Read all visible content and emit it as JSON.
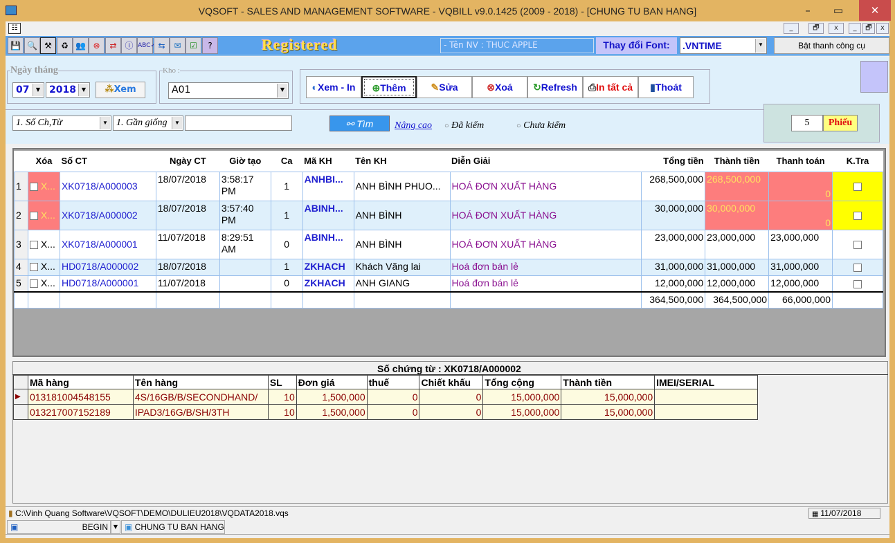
{
  "window": {
    "title": "VQSOFT - SALES AND MANAGEMENT SOFTWARE - VQBILL v9.0.1425 (2009 - 2018) - [CHUNG TU BAN HANG]",
    "minimize": "–",
    "maximize": "▭",
    "close": "✕"
  },
  "mdi": {
    "minimize": "_",
    "restore": "🗗",
    "close": "x"
  },
  "toolbar": {
    "icons": [
      "save-icon",
      "search-user-icon",
      "tools-icon",
      "refresh-doc-icon",
      "users-icon",
      "cancel-icon",
      "exchange-icon",
      "info-icon",
      "spellcheck-icon",
      "teamviewer-icon",
      "mail-icon",
      "check-icon",
      "help-icon"
    ],
    "registered": "Registered",
    "employee": "- Tên NV : THUC APPLE",
    "font_label": "Thay đổi Font:",
    "font_value": ".VNTIME",
    "toggle_toolbar": "Bật thanh công cụ"
  },
  "filters": {
    "date_legend": "Ngày tháng",
    "month": "07",
    "year": "2018",
    "view": "Xem",
    "warehouse_legend": "Kho :",
    "warehouse": "A01"
  },
  "actions": {
    "print": "Xem - In",
    "add": "Thêm",
    "edit": "Sửa",
    "delete": "Xoá",
    "refresh": "Refresh",
    "print_all": "In tất cả",
    "exit": "Thoát"
  },
  "search": {
    "field": "1. Số Ch,Từ",
    "mode": "1. Gần giống",
    "value": "",
    "find": "Tìm",
    "advanced": "Nâng cao",
    "checked": "Đã kiểm",
    "unchecked": "Chưa  kiểm",
    "count": "5",
    "count_label": "Phiếu"
  },
  "grid": {
    "columns": [
      "Xóa",
      "Số CT",
      "Ngày CT",
      "Giờ tạo",
      "Ca",
      "Mã KH",
      "Tên KH",
      "Diễn Giải",
      "Tổng tiền",
      "Thành tiền",
      "Thanh toán",
      "K.Tra"
    ],
    "rows": [
      {
        "n": "1",
        "x": "X...",
        "so": "XK0718/A000003",
        "ngay": "18/07/2018",
        "gio": "3:58:17 PM",
        "ca": "1",
        "ma": "ANHBI...",
        "ten": "ANH BÌNH PHUO...",
        "dg": "HOÁ ĐƠN XUẤT HÀNG",
        "tong": "268,500,000",
        "thanh": "268,500,000",
        "tt": "0"
      },
      {
        "n": "2",
        "x": "X...",
        "so": "XK0718/A000002",
        "ngay": "18/07/2018",
        "gio": "3:57:40 PM",
        "ca": "1",
        "ma": "ABINH...",
        "ten": "ANH BÌNH",
        "dg": "HOÁ ĐƠN XUẤT HÀNG",
        "tong": "30,000,000",
        "thanh": "30,000,000",
        "tt": "0"
      },
      {
        "n": "3",
        "x": "X...",
        "so": "XK0718/A000001",
        "ngay": "11/07/2018",
        "gio": "8:29:51 AM",
        "ca": "0",
        "ma": "ABINH...",
        "ten": "ANH BÌNH",
        "dg": "HOÁ ĐƠN XUẤT HÀNG",
        "tong": "23,000,000",
        "thanh": "23,000,000",
        "tt": "23,000,000"
      },
      {
        "n": "4",
        "x": "X...",
        "so": "HD0718/A000002",
        "ngay": "18/07/2018",
        "gio": "",
        "ca": "1",
        "ma": "ZKHACH",
        "ten": " Khách Vãng lai",
        "dg": "Hoá đơn bán lẻ",
        "tong": "31,000,000",
        "thanh": "31,000,000",
        "tt": "31,000,000"
      },
      {
        "n": "5",
        "x": "X...",
        "so": "HD0718/A000001",
        "ngay": "11/07/2018",
        "gio": "",
        "ca": "0",
        "ma": "ZKHACH",
        "ten": "ANH GIANG",
        "dg": "Hoá đơn bán lẻ",
        "tong": "12,000,000",
        "thanh": "12,000,000",
        "tt": "12,000,000"
      }
    ],
    "totals": {
      "tong": "364,500,000",
      "thanh": "364,500,000",
      "tt": "66,000,000"
    }
  },
  "detail": {
    "title": "Số chứng từ : XK0718/A000002",
    "columns": [
      "Mã hàng",
      "Tên hàng",
      "SL",
      "Đơn giá",
      "thuế",
      "Chiết khấu",
      "Tổng cộng",
      "Thành tiền",
      "IMEI/SERIAL"
    ],
    "rows": [
      {
        "ma": "013181004548155",
        "ten": "4S/16GB/B/SECONDHAND/",
        "sl": "10",
        "dg": "1,500,000",
        "thue": "0",
        "ck": "0",
        "tong": "15,000,000",
        "thanh": "15,000,000",
        "imei": ""
      },
      {
        "ma": "013217007152189",
        "ten": "IPAD3/16G/B/SH/3TH",
        "sl": "10",
        "dg": "1,500,000",
        "thue": "0",
        "ck": "0",
        "tong": "15,000,000",
        "thanh": "15,000,000",
        "imei": ""
      }
    ]
  },
  "status": {
    "path": "C:\\Vinh Quang Software\\VQSOFT\\DEMO\\DULIEU2018\\VQDATA2018.vqs",
    "date": "11/07/2018"
  },
  "taskbar": {
    "begin": "BEGIN",
    "window": "CHUNG TU BAN HANG"
  }
}
